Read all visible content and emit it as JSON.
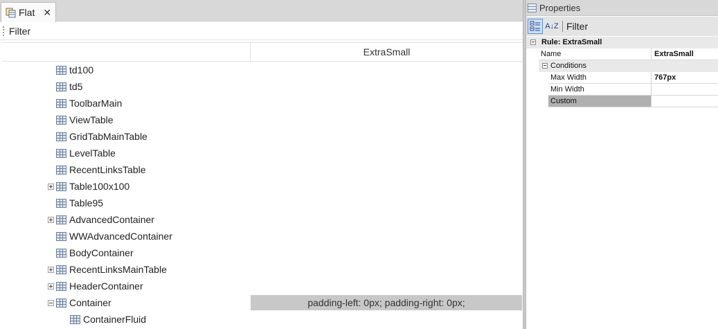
{
  "flat_pane": {
    "tab_title": "Flat",
    "tab_close": "✕",
    "filter_label": "Filter",
    "column_header": "ExtraSmall",
    "rows": [
      {
        "label": "td100",
        "expander": "none",
        "value": ""
      },
      {
        "label": "td5",
        "expander": "none",
        "value": ""
      },
      {
        "label": "ToolbarMain",
        "expander": "none",
        "value": ""
      },
      {
        "label": "ViewTable",
        "expander": "none",
        "value": ""
      },
      {
        "label": "GridTabMainTable",
        "expander": "none",
        "value": ""
      },
      {
        "label": "LevelTable",
        "expander": "none",
        "value": ""
      },
      {
        "label": "RecentLinksTable",
        "expander": "none",
        "value": ""
      },
      {
        "label": "Table100x100",
        "expander": "plus",
        "value": ""
      },
      {
        "label": "Table95",
        "expander": "none",
        "value": ""
      },
      {
        "label": "AdvancedContainer",
        "expander": "plus",
        "value": ""
      },
      {
        "label": "WWAdvancedContainer",
        "expander": "none",
        "value": ""
      },
      {
        "label": "BodyContainer",
        "expander": "none",
        "value": ""
      },
      {
        "label": "RecentLinksMainTable",
        "expander": "plus",
        "value": ""
      },
      {
        "label": "HeaderContainer",
        "expander": "plus",
        "value": ""
      },
      {
        "label": "Container",
        "expander": "minus",
        "value": "padding-left: 0px;  padding-right: 0px;"
      },
      {
        "label": "ContainerFluid",
        "expander": "none",
        "value": ""
      }
    ]
  },
  "properties": {
    "title": "Properties",
    "toolbar": {
      "categorized_icon": "categorized-icon",
      "sort_icon": "sort-az-icon",
      "sort_glyph": "A↓Z",
      "filter_label": "Filter"
    },
    "rule_header": "Rule: ExtraSmall",
    "name_label": "Name",
    "name_value": "ExtraSmall",
    "conditions_header": "Conditions",
    "props": [
      {
        "name": "Max Width",
        "value": "767px"
      },
      {
        "name": "Min Width",
        "value": ""
      },
      {
        "name": "Custom",
        "value": "",
        "selected": true
      }
    ]
  }
}
